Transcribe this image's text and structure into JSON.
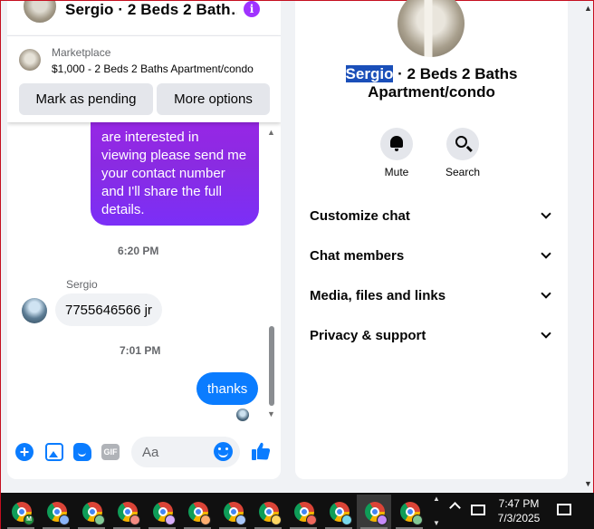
{
  "chat": {
    "title": "Sergio · 2 Beds 2 Bath…",
    "marketplace": {
      "label": "Marketplace",
      "listing": "$1,000 - 2 Beds 2 Baths Apartment/condo",
      "pending_button": "Mark as pending",
      "more_button": "More options"
    },
    "messages": {
      "outgoing_lines": [
        "are interested in",
        "viewing please send me",
        "your contact number",
        "and I'll share the full",
        "details."
      ],
      "time_1": "6:20 PM",
      "sender": "Sergio",
      "incoming": "7755646566 jr",
      "time_2": "7:01 PM",
      "outgoing_2": "thanks"
    },
    "composer": {
      "placeholder": "Aa",
      "gif_label": "GIF"
    }
  },
  "details": {
    "name_highlight": "Sergio",
    "title_rest": " · 2 Beds 2 Baths",
    "title_line2": "Apartment/condo",
    "actions": {
      "mute": "Mute",
      "search": "Search"
    },
    "sections": [
      "Customize chat",
      "Chat members",
      "Media, files and links",
      "Privacy & support"
    ]
  },
  "taskbar": {
    "apps": [
      {
        "profile_color": "#1e8e3e",
        "profile_letter": "M"
      },
      {
        "profile_color": "#8ab4f8",
        "profile_letter": ""
      },
      {
        "profile_color": "#81c995",
        "profile_letter": ""
      },
      {
        "profile_color": "#f28b82",
        "profile_letter": ""
      },
      {
        "profile_color": "#d7aefb",
        "profile_letter": ""
      },
      {
        "profile_color": "#fcad70",
        "profile_letter": ""
      },
      {
        "profile_color": "#a8c7fa",
        "profile_letter": ""
      },
      {
        "profile_color": "#fdd663",
        "profile_letter": ""
      },
      {
        "profile_color": "#ee675c",
        "profile_letter": ""
      },
      {
        "profile_color": "#78d9ec",
        "profile_letter": ""
      },
      {
        "profile_color": "#c58af9",
        "profile_letter": ""
      },
      {
        "profile_color": "#81c995",
        "profile_letter": ""
      }
    ],
    "time": "7:47 PM",
    "date": "7/3/2025"
  },
  "colors": {
    "accent": "#0a7cff",
    "outgoing_gradient_start": "#a023e8",
    "outgoing_gradient_end": "#7b2ff7",
    "name_highlight_bg": "#1a4fb9"
  }
}
